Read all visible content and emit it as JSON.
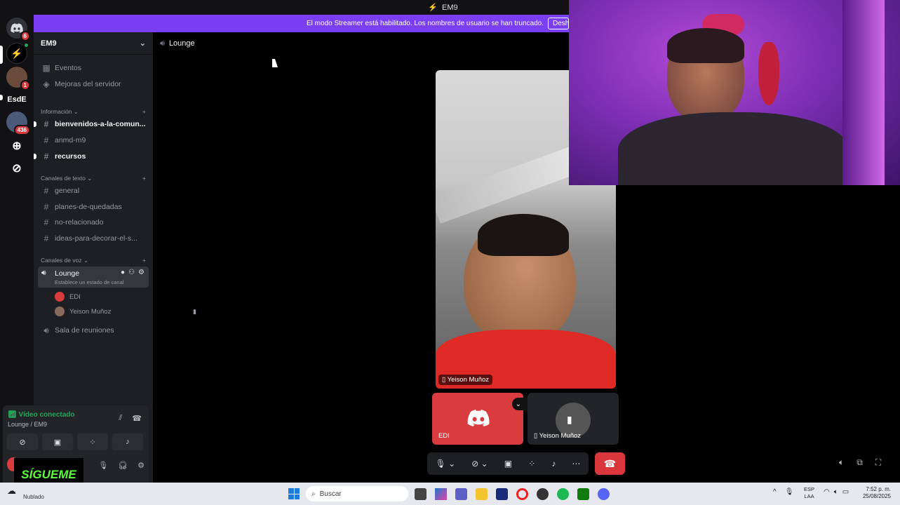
{
  "window": {
    "title": "EM9"
  },
  "banner": {
    "text": "El modo Streamer está habilitado. Los nombres de usuario se han truncado.",
    "button": "Desha"
  },
  "rail": {
    "servers": [
      {
        "badge": "6"
      },
      {
        "badge": ""
      },
      {
        "badge": "1"
      },
      {
        "label": "EsdE"
      },
      {
        "badge": "436"
      }
    ]
  },
  "server": {
    "name": "EM9"
  },
  "sidebar": {
    "top_items": [
      "Eventos",
      "Mejoras del servidor"
    ],
    "categories": {
      "info": "Información",
      "text": "Canales de texto",
      "voice": "Canales de voz"
    },
    "info_channels": [
      "bienvenidos-a-la-comun...",
      "anmd-m9",
      "recursos"
    ],
    "text_channels": [
      "general",
      "planes-de-quedadas",
      "no-relacionado",
      "ideas-para-decorar-el-s..."
    ],
    "voice_channels": {
      "lounge": "Lounge",
      "lounge_status": "Establece un estado de canal",
      "meeting": "Sala de reuniones"
    },
    "voice_users": [
      "EDI",
      "Yeison Muñoz"
    ]
  },
  "voice_panel": {
    "status": "Vídeo conectado",
    "location": "Lounge / EM9"
  },
  "channel_header": {
    "name": "Lounge"
  },
  "tiles": {
    "main_name": "Yeison Muñoz",
    "edi_name": "EDI",
    "small_name": "Yeison Muñoz"
  },
  "overlay": {
    "sigueme": "SÍGUEME"
  },
  "taskbar": {
    "weather": "Nublado",
    "search_placeholder": "Buscar",
    "lang": "ESP",
    "lang2": "LAA",
    "time": "7:52 p. m.",
    "date": "25/08/2025"
  }
}
